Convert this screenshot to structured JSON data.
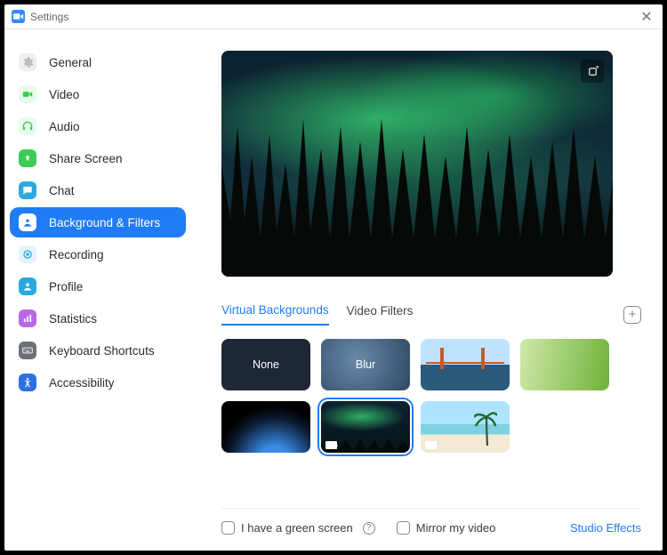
{
  "window": {
    "title": "Settings"
  },
  "sidebar": {
    "items": [
      {
        "label": "General"
      },
      {
        "label": "Video"
      },
      {
        "label": "Audio"
      },
      {
        "label": "Share Screen"
      },
      {
        "label": "Chat"
      },
      {
        "label": "Background & Filters"
      },
      {
        "label": "Recording"
      },
      {
        "label": "Profile"
      },
      {
        "label": "Statistics"
      },
      {
        "label": "Keyboard Shortcuts"
      },
      {
        "label": "Accessibility"
      }
    ],
    "active_index": 5
  },
  "tabs": {
    "virtual_backgrounds": "Virtual Backgrounds",
    "video_filters": "Video Filters",
    "active": "virtual_backgrounds"
  },
  "thumbnails": {
    "none_label": "None",
    "blur_label": "Blur",
    "selected_index": 5
  },
  "footer": {
    "green_screen": "I have a green screen",
    "mirror": "Mirror my video",
    "studio_effects": "Studio Effects"
  }
}
